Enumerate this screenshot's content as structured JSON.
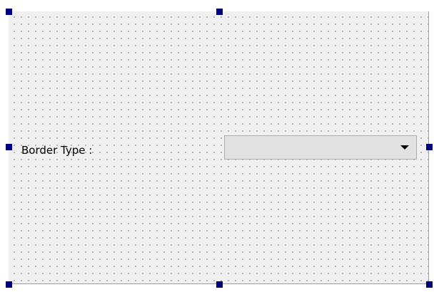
{
  "form": {
    "label": "Border Type :",
    "combo_value": ""
  },
  "colors": {
    "handle": "#000080",
    "form_background": "#f0f0f0",
    "grid_dot": "#9a9a9a",
    "combo_background": "#e1e1e1"
  },
  "icons": {
    "combo_arrow": "triangle-down-icon"
  }
}
